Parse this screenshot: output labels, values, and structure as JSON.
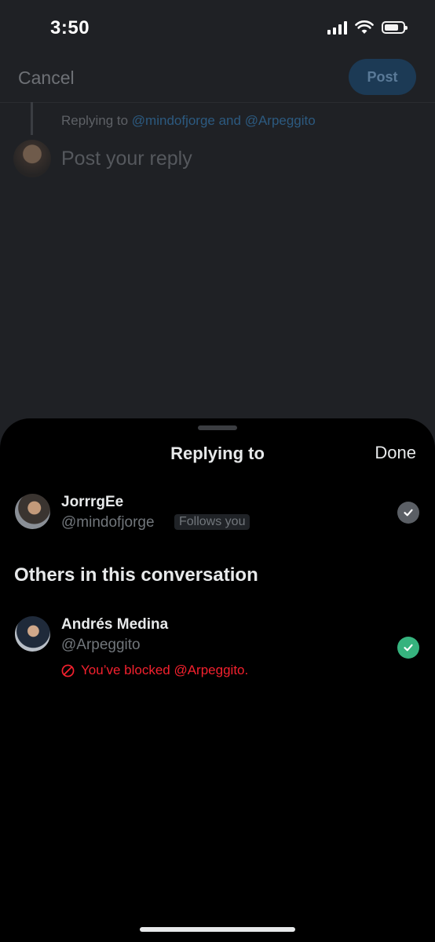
{
  "status_bar": {
    "time": "3:50"
  },
  "compose": {
    "cancel_label": "Cancel",
    "post_label": "Post",
    "replying_prefix": "Replying to",
    "replying_handles": "@mindofjorge and @Arpeggito",
    "placeholder": "Post your reply"
  },
  "sheet": {
    "title": "Replying to",
    "done_label": "Done",
    "primary_user": {
      "name": "JorrrgEe",
      "handle": "@mindofjorge",
      "badge": "Follows you",
      "checked": true
    },
    "others_title": "Others in this conversation",
    "others": [
      {
        "name": "Andrés Medina",
        "handle": "@Arpeggito",
        "blocked_notice": "You’ve blocked @Arpeggito.",
        "checked": true
      }
    ]
  },
  "colors": {
    "accent_green": "#36b37e",
    "blocked_red": "#f4212e",
    "sheet_bg": "#000000",
    "dimmed_bg": "#1f2125"
  }
}
